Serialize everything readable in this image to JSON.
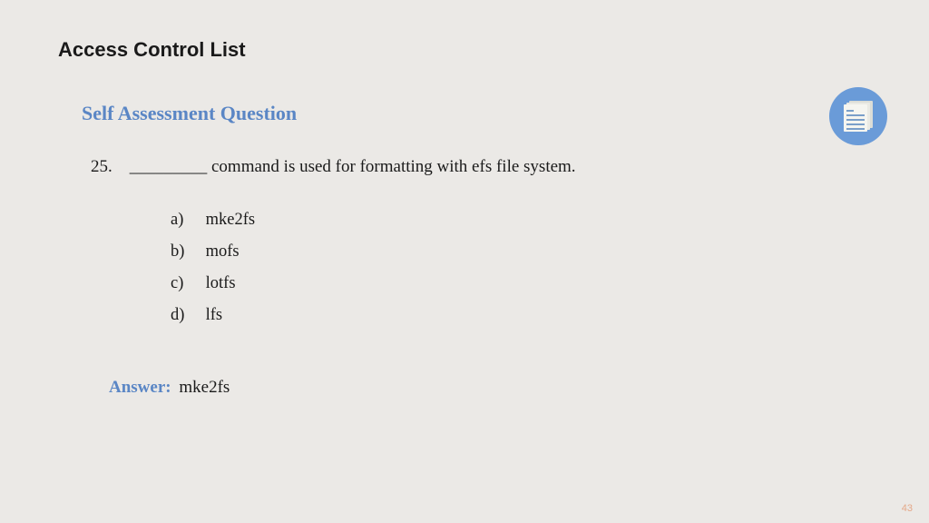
{
  "header": {
    "title": "Access Control List"
  },
  "section": {
    "title": "Self Assessment Question"
  },
  "question": {
    "number": "25.",
    "text": "_________ command is used for formatting with efs file system."
  },
  "options": [
    {
      "letter": "a)",
      "text": "mke2fs"
    },
    {
      "letter": "b)",
      "text": "mofs"
    },
    {
      "letter": "c)",
      "text": "lotfs"
    },
    {
      "letter": "d)",
      "text": "lfs"
    }
  ],
  "answer": {
    "label": "Answer:",
    "value": "mke2fs"
  },
  "page_number": "43"
}
